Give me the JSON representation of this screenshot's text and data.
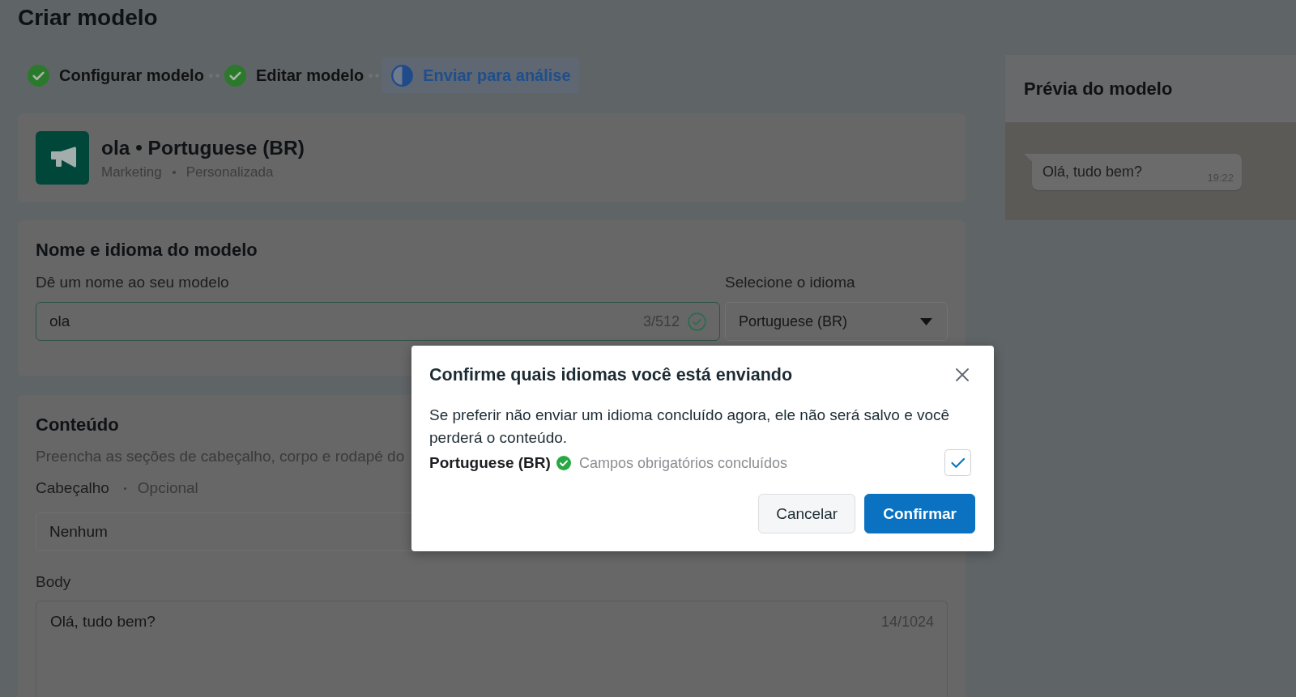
{
  "page": {
    "title": "Criar modelo"
  },
  "stepper": [
    {
      "label": "Configurar modelo",
      "complete": true,
      "selected": false
    },
    {
      "label": "Editar modelo",
      "complete": true,
      "selected": false
    },
    {
      "label": "Enviar para análise",
      "complete": false,
      "selected": true
    }
  ],
  "template": {
    "title": "ola • Portuguese (BR)",
    "category": "Marketing",
    "type": "Personalizada"
  },
  "name_section": {
    "title": "Nome e idioma do modelo",
    "name_label": "Dê um nome ao seu modelo",
    "name_value": "ola",
    "name_counter": "3/512",
    "name_valid": true,
    "language_label": "Selecione o idioma",
    "language_value": "Portuguese (BR)"
  },
  "content_section": {
    "title": "Conteúdo",
    "description": "Preencha as seções de cabeçalho, corpo e rodapé do",
    "header_label": "Cabeçalho",
    "header_hint": "Opcional",
    "header_value": "Nenhum",
    "body_label": "Body",
    "body_value": "Olá, tudo bem?",
    "body_counter": "14/1024"
  },
  "preview": {
    "title": "Prévia do modelo",
    "message": "Olá, tudo bem?",
    "time": "19:22"
  },
  "dialog": {
    "title": "Confirme quais idiomas você está enviando",
    "message": "Se preferir não enviar um idioma concluído agora, ele não será salvo e você perderá o conteúdo.",
    "languages": [
      {
        "name": "Portuguese (BR)",
        "complete": true,
        "status": "Campos obrigatórios concluídos",
        "checked": true
      }
    ],
    "buttons": [
      {
        "label": "Cancelar",
        "kind": "secondary"
      },
      {
        "label": "Confirmar",
        "kind": "primary"
      }
    ]
  }
}
